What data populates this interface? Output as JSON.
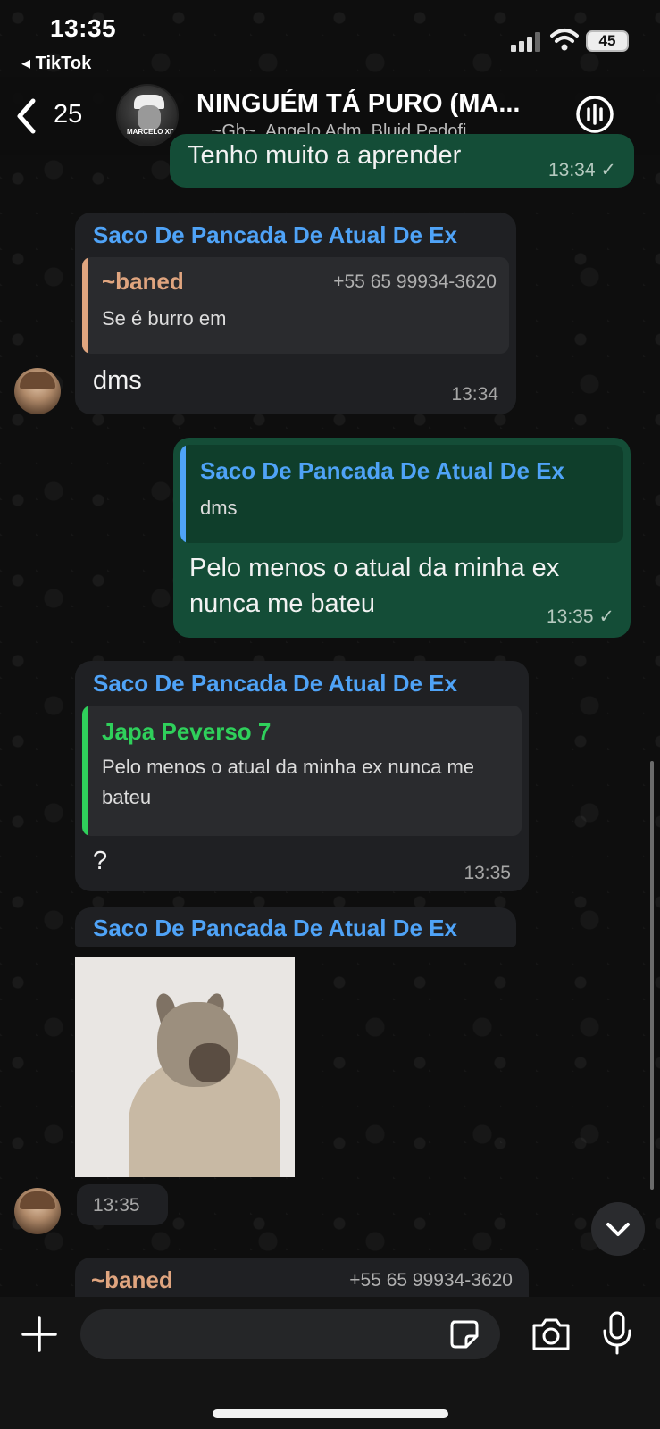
{
  "status_bar": {
    "time": "13:35",
    "back_app": "◂ TikTok",
    "battery": "45"
  },
  "header": {
    "back_count": "25",
    "avatar_label": "MARCELO XIT",
    "title": "NINGUÉM TÁ PURO (MA...",
    "subtitle": "., ~Gb~, Angelo Adm, Bluid Pedofi..."
  },
  "messages": [
    {
      "type": "outgoing",
      "text": "Tenho muito a aprender",
      "time": "13:34"
    },
    {
      "type": "incoming",
      "sender": "Saco De Pancada De Atual De Ex",
      "quote": {
        "name": "~baned",
        "phone": "+55 65 99934-3620",
        "text": "Se é burro em",
        "color": "#e0a57f"
      },
      "text": "dms",
      "time": "13:34"
    },
    {
      "type": "outgoing",
      "quote": {
        "name": "Saco De Pancada De Atual De Ex",
        "text": "dms",
        "color": "#4fa3f7"
      },
      "text": "Pelo menos o atual da minha ex nunca me bateu",
      "time": "13:35"
    },
    {
      "type": "incoming",
      "sender": "Saco De Pancada De Atual De Ex",
      "quote": {
        "name": "Japa Peverso 7",
        "text": "Pelo menos o atual da minha ex nunca me bateu",
        "color": "#2fd05b"
      },
      "text": "?",
      "time": "13:35"
    },
    {
      "type": "incoming-image",
      "sender": "Saco De Pancada De Atual De Ex",
      "time": "13:35"
    },
    {
      "type": "incoming-partial",
      "name": "~baned",
      "phone": "+55 65 99934-3620"
    }
  ],
  "composer": {
    "placeholder": ""
  },
  "colors": {
    "outgoing_bubble": "#144d37",
    "incoming_bubble": "#1f2023",
    "sender_blue": "#4fa3f7",
    "baned_orange": "#e0a57f",
    "japa_green": "#2fd05b"
  }
}
